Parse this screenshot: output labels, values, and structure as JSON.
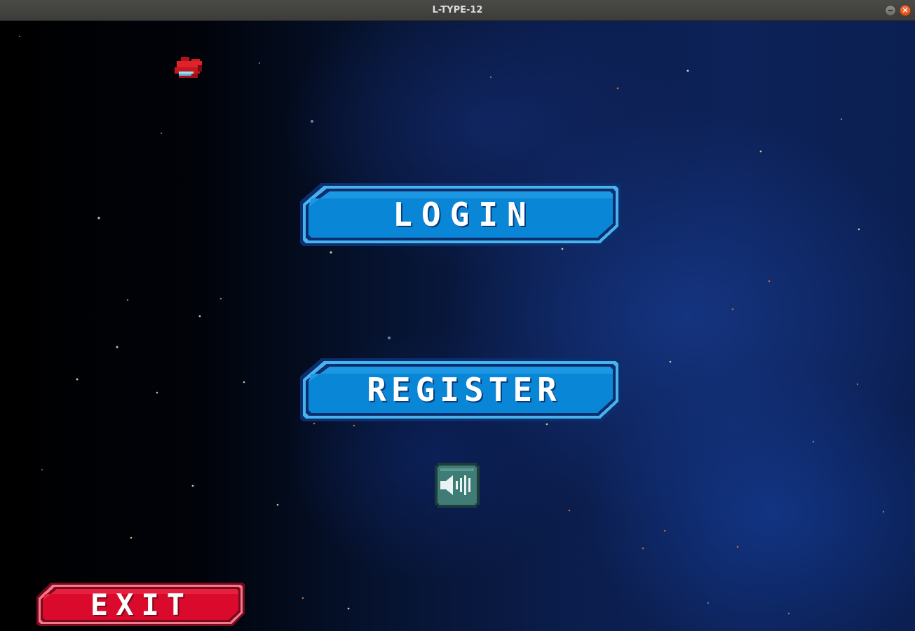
{
  "window": {
    "title": "L-TYPE-12",
    "close_glyph": "×"
  },
  "menu": {
    "login_label": "LOGIN",
    "register_label": "REGISTER",
    "exit_label": "EXIT",
    "sound_icon": "speaker-on-icon"
  },
  "colors": {
    "button_blue": "#0a86d6",
    "button_blue_border": "#0b2f6e",
    "exit_red": "#d90a2c",
    "sound_teal": "#3f7c76"
  }
}
